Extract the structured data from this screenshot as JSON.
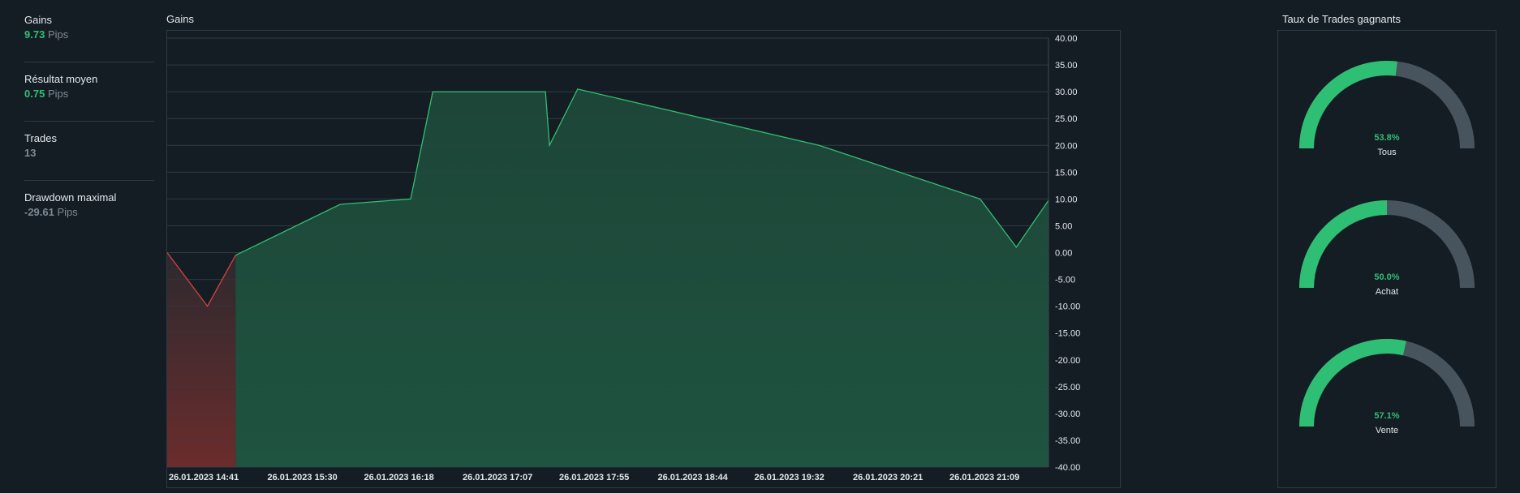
{
  "stats": [
    {
      "label": "Gains",
      "value": "9.73",
      "unit": "Pips",
      "tone": "pos"
    },
    {
      "label": "Résultat moyen",
      "value": "0.75",
      "unit": "Pips",
      "tone": "pos"
    },
    {
      "label": "Trades",
      "value": "13",
      "unit": "",
      "tone": "neutral"
    },
    {
      "label": "Drawdown maximal",
      "value": "-29.61",
      "unit": "Pips",
      "tone": "neg"
    }
  ],
  "chart_title": "Gains",
  "gauges_title": "Taux de Trades gagnants",
  "colors": {
    "positive": "#2fbf74",
    "negative": "#d64040",
    "gauge_bg": "#47545d",
    "grid": "#2a363f"
  },
  "chart_data": {
    "type": "area",
    "title": "Gains",
    "x_labels": [
      "26.01.2023 14:41",
      "26.01.2023 15:30",
      "26.01.2023 16:18",
      "26.01.2023 17:07",
      "26.01.2023 17:55",
      "26.01.2023 18:44",
      "26.01.2023 19:32",
      "26.01.2023 20:21",
      "26.01.2023 21:09"
    ],
    "x_minutes": [
      0,
      49,
      97,
      146,
      194,
      243,
      291,
      340,
      388
    ],
    "ylim": [
      -40,
      40
    ],
    "y_ticks": [
      "40.00",
      "35.00",
      "30.00",
      "25.00",
      "20.00",
      "15.00",
      "10.00",
      "5.00",
      "0.00",
      "-5.00",
      "-10.00",
      "-15.00",
      "-20.00",
      "-25.00",
      "-30.00",
      "-35.00",
      "-40.00"
    ],
    "grid": true,
    "points": [
      {
        "t": 0,
        "y": 0
      },
      {
        "t": 20,
        "y": -10
      },
      {
        "t": 34,
        "y": -0.5
      },
      {
        "t": 86,
        "y": 9
      },
      {
        "t": 121,
        "y": 10
      },
      {
        "t": 132,
        "y": 30
      },
      {
        "t": 188,
        "y": 30
      },
      {
        "t": 190,
        "y": 20
      },
      {
        "t": 204,
        "y": 30.5
      },
      {
        "t": 324,
        "y": 20
      },
      {
        "t": 404,
        "y": 10
      },
      {
        "t": 422,
        "y": 1
      },
      {
        "t": 438,
        "y": 9.73
      }
    ]
  },
  "gauges": [
    {
      "label": "Tous",
      "value": 53.8,
      "text": "53.8%"
    },
    {
      "label": "Achat",
      "value": 50.0,
      "text": "50.0%"
    },
    {
      "label": "Vente",
      "value": 57.1,
      "text": "57.1%"
    }
  ]
}
